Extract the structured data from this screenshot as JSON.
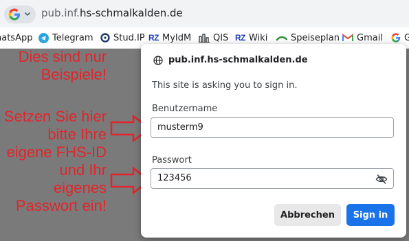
{
  "address_bar": {
    "url_prefix": "pub.inf.",
    "url_domain": "hs-schmalkalden.de"
  },
  "bookmarks": [
    {
      "label": "hatsApp",
      "icon": "whatsapp-icon"
    },
    {
      "label": "Telegram",
      "icon": "telegram-icon"
    },
    {
      "label": "Stud.IP",
      "icon": "studip-icon"
    },
    {
      "label": "MyIdM",
      "icon_text": "RZ"
    },
    {
      "label": "QIS",
      "icon": "qis-icon"
    },
    {
      "label": "Wiki",
      "icon_text": "RZ"
    },
    {
      "label": "Speiseplan",
      "icon": "speiseplan-icon"
    },
    {
      "label": "Gmail",
      "icon": "gmail-icon"
    },
    {
      "label": "G"
    }
  ],
  "annotation": {
    "line1": "Dies sind nur",
    "line2": "Beispiele!",
    "line3": "Setzen Sie hier",
    "line4": "bitte Ihre",
    "line5": "eigene FHS-ID",
    "line6": "und Ihr",
    "line7": "eigenes",
    "line8": "Passwort ein!",
    "color": "#e3242b"
  },
  "dialog": {
    "host": "pub.inf.hs-schmalkalden.de",
    "message": "This site is asking you to sign in.",
    "username_label": "Benutzername",
    "username_value": "musterm9",
    "password_label": "Passwort",
    "password_value": "123456",
    "cancel_label": "Abbrechen",
    "sign_in_label": "Sign in",
    "accent": "#1a73e8"
  }
}
